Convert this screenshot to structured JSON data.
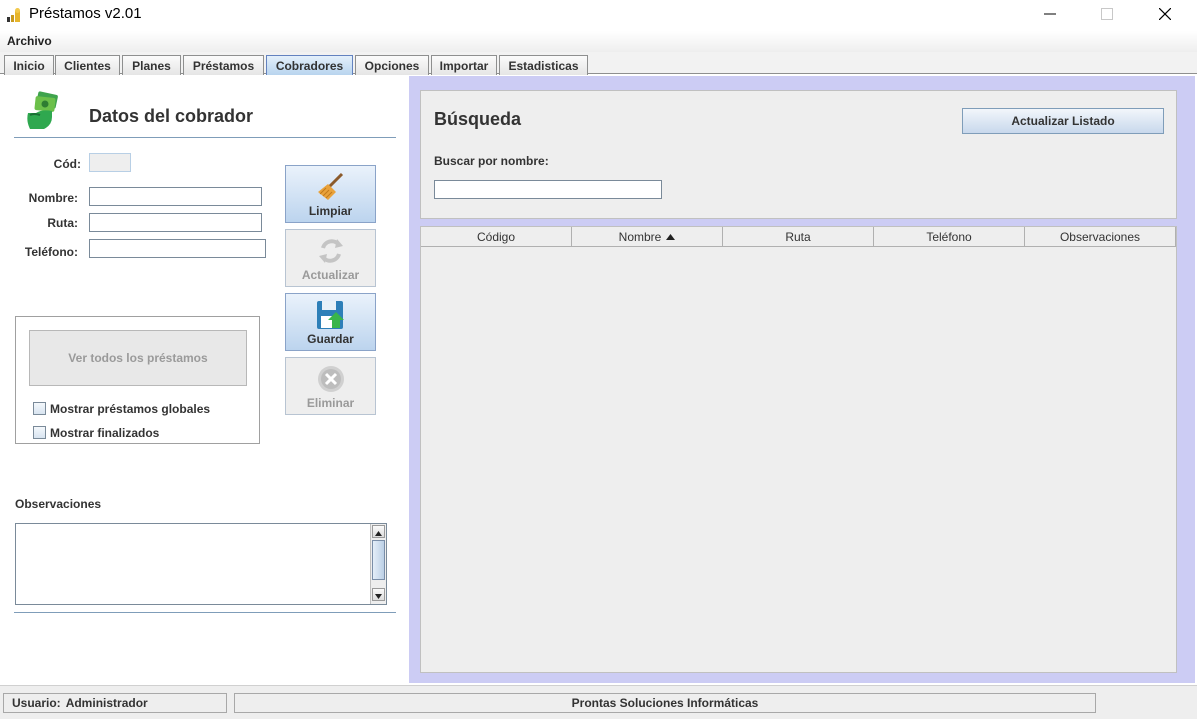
{
  "window": {
    "title": "Préstamos v2.01"
  },
  "menu": {
    "file_label": "Archivo"
  },
  "tabs": [
    {
      "label": "Inicio"
    },
    {
      "label": "Clientes"
    },
    {
      "label": "Planes"
    },
    {
      "label": "Préstamos"
    },
    {
      "label": "Cobradores",
      "active": true
    },
    {
      "label": "Opciones"
    },
    {
      "label": "Importar"
    },
    {
      "label": "Estadisticas"
    }
  ],
  "form": {
    "title": "Datos del cobrador",
    "code_label": "Cód:",
    "code_value": "",
    "name_label": "Nombre:",
    "name_value": "",
    "route_label": "Ruta:",
    "route_value": "",
    "phone_label": "Teléfono:",
    "phone_value": "",
    "observations_label": "Observaciones",
    "observations_value": ""
  },
  "actions": {
    "clear_label": "Limpiar",
    "update_label": "Actualizar",
    "save_label": "Guardar",
    "delete_label": "Eliminar"
  },
  "loans_group": {
    "view_all_label": "Ver todos los préstamos",
    "show_global_label": "Mostrar préstamos globales",
    "show_global_checked": false,
    "show_finished_label": "Mostrar finalizados",
    "show_finished_checked": false
  },
  "search": {
    "title": "Búsqueda",
    "refresh_label": "Actualizar Listado",
    "by_name_label": "Buscar por nombre:",
    "query": ""
  },
  "table": {
    "columns": [
      "Código",
      "Nombre",
      "Ruta",
      "Teléfono",
      "Observaciones"
    ],
    "sort_column": "Nombre",
    "sort_direction": "ascending",
    "rows": []
  },
  "status": {
    "user_label": "Usuario:",
    "user_value": "Administrador",
    "company": "Prontas Soluciones Informáticas"
  },
  "icons": {
    "app": "coins-icon",
    "collector": "money-hand-icon",
    "clear": "broom-icon",
    "update": "refresh-icon",
    "save": "floppy-disk-icon",
    "delete": "delete-icon"
  }
}
